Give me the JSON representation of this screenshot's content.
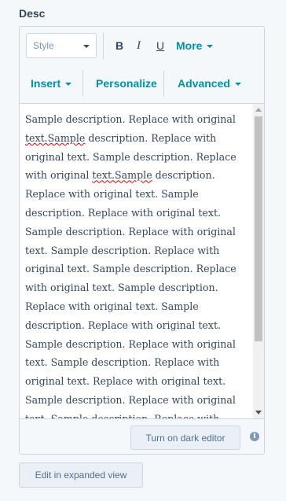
{
  "field": {
    "label": "Desc"
  },
  "toolbar": {
    "style_placeholder": "Style",
    "bold": "B",
    "italic": "I",
    "underline": "U",
    "more": "More",
    "insert": "Insert",
    "personalize": "Personalize",
    "advanced": "Advanced"
  },
  "content": {
    "text_part1": "Sample description. Replace with original ",
    "misspelled1": "text.Sample",
    "text_part2": " description. Replace with original text. Sample description. Replace with original ",
    "misspelled2": "text.Sample",
    "text_part3": " description. Replace with original text. Sample description. Replace with original text. Sample description. Replace with original text. Sample description. Replace with original text. Sample description. Replace with original text. Sample description. Replace with original text. Sample description. Replace with original text. Sample description. Replace with original text. Sample description. Replace with original text. Replace with original text. Sample description. Replace with original text. Sample description. Replace with original text."
  },
  "footer": {
    "dark_editor_button": "Turn on dark editor",
    "info_icon": "i",
    "expand_button": "Edit in expanded view"
  },
  "colors": {
    "accent": "#0091ae",
    "text": "#33475b",
    "border": "#cbd6e2",
    "background": "#f5f8fa"
  },
  "icons": {
    "style_caret": "chevron-down-icon",
    "info": "info-icon"
  }
}
